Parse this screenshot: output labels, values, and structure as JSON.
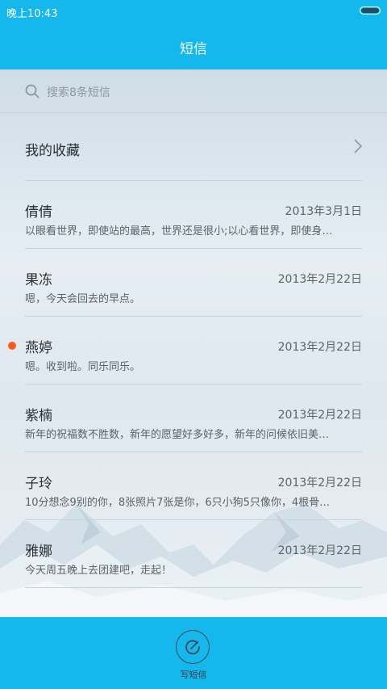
{
  "status_bar": {
    "time": "晚上10:43"
  },
  "header": {
    "title": "短信"
  },
  "search": {
    "placeholder": "搜索8条短信"
  },
  "favorites": {
    "label": "我的收藏"
  },
  "conversations": [
    {
      "name": "倩倩",
      "date": "2013年3月1日",
      "preview": "以眼看世界，即使站的最高，世界还是很小;以心看世界，即使身…",
      "unread": false
    },
    {
      "name": "果冻",
      "date": "2013年2月22日",
      "preview": "嗯，今天会回去的早点。",
      "unread": false
    },
    {
      "name": "燕婷",
      "date": "2013年2月22日",
      "preview": "嗯。收到啦。同乐同乐。",
      "unread": true
    },
    {
      "name": "紫楠",
      "date": "2013年2月22日",
      "preview": "新年的祝福数不胜数，新年的愿望好多好多，新年的问候依旧美…",
      "unread": false
    },
    {
      "name": "子玲",
      "date": "2013年2月22日",
      "preview": "10分想念9别的你，8张照片7张是你，6只小狗5只像你，4根骨…",
      "unread": false
    },
    {
      "name": "雅娜",
      "date": "2013年2月22日",
      "preview": "今天周五晚上去团建吧，走起！",
      "unread": false
    }
  ],
  "footer": {
    "compose_label": "写短信"
  },
  "colors": {
    "accent": "#14b8ec",
    "unread_dot": "#ff5a1e"
  },
  "icons": {
    "search": "search-icon",
    "chevron": "chevron-right-icon",
    "compose": "compose-icon"
  }
}
